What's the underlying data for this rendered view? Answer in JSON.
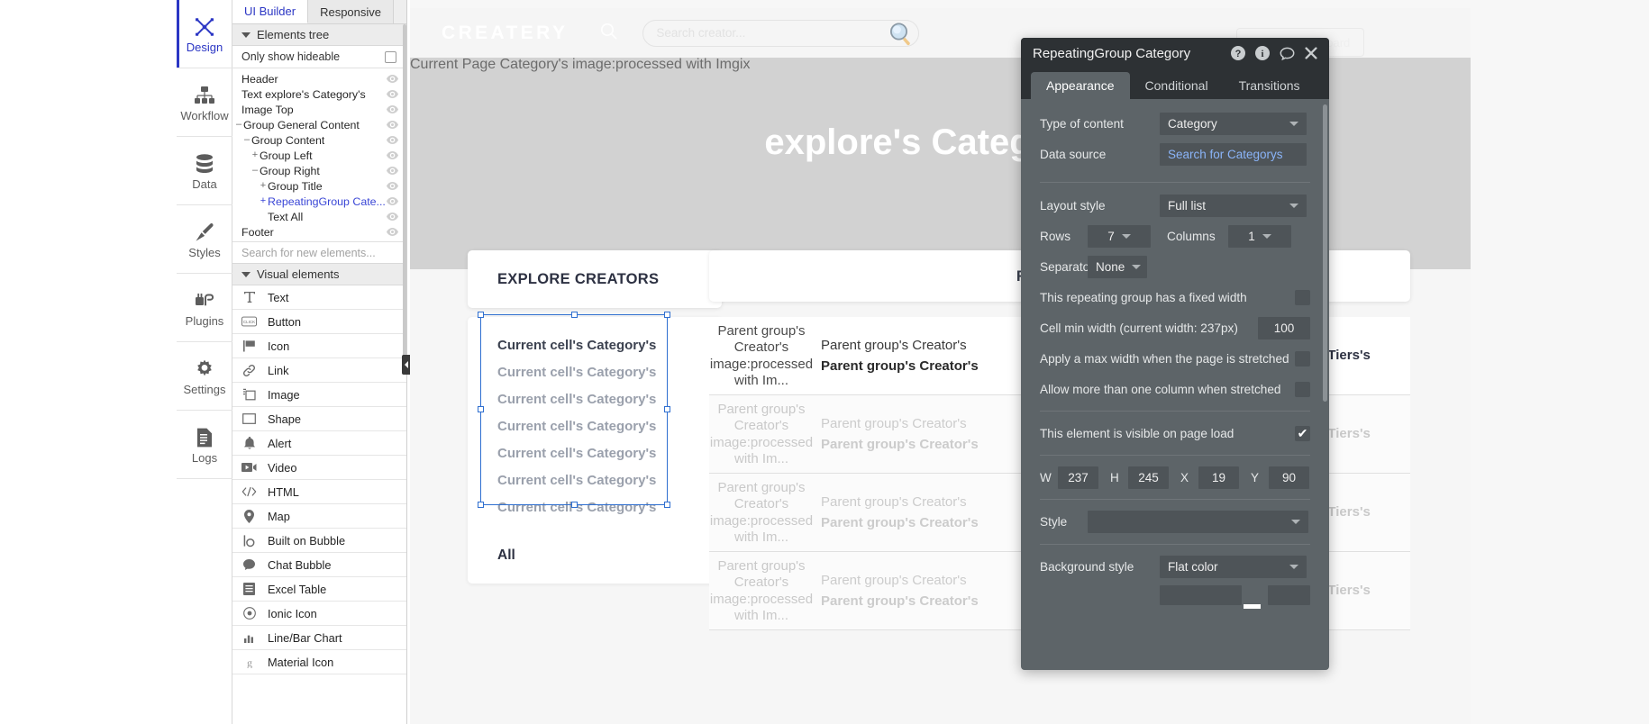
{
  "builder": {
    "tabs": [
      {
        "label": "UI Builder",
        "active": true
      },
      {
        "label": "Responsive",
        "active": false
      }
    ]
  },
  "nav_rail": {
    "items": [
      {
        "label": "Design",
        "icon": "design-icon",
        "active": true
      },
      {
        "label": "Workflow",
        "icon": "workflow-icon",
        "active": false
      },
      {
        "label": "Data",
        "icon": "database-icon",
        "active": false
      },
      {
        "label": "Styles",
        "icon": "brush-icon",
        "active": false
      },
      {
        "label": "Plugins",
        "icon": "plug-icon",
        "active": false
      },
      {
        "label": "Settings",
        "icon": "gear-icon",
        "active": false
      },
      {
        "label": "Logs",
        "icon": "document-icon",
        "active": false
      }
    ]
  },
  "elements_tree": {
    "section_label": "Elements tree",
    "hideable_label": "Only show hideable",
    "hideable_checked": false,
    "search_placeholder": "Search for new elements...",
    "nodes": [
      {
        "label": "Header",
        "indent": 0,
        "twist": "",
        "selected": false
      },
      {
        "label": "Text explore's Category's",
        "indent": 0,
        "twist": "",
        "selected": false
      },
      {
        "label": "Image Top",
        "indent": 0,
        "twist": "",
        "selected": false
      },
      {
        "label": "Group General Content",
        "indent": 0,
        "twist": "–",
        "selected": false
      },
      {
        "label": "Group Content",
        "indent": 1,
        "twist": "–",
        "selected": false
      },
      {
        "label": "Group Left",
        "indent": 2,
        "twist": "+",
        "selected": false
      },
      {
        "label": "Group Right",
        "indent": 2,
        "twist": "–",
        "selected": false
      },
      {
        "label": "Group Title",
        "indent": 3,
        "twist": "+",
        "selected": false
      },
      {
        "label": "RepeatingGroup Cate...",
        "indent": 3,
        "twist": "+",
        "selected": true
      },
      {
        "label": "Text All",
        "indent": 3,
        "twist": "",
        "selected": false
      },
      {
        "label": "Footer",
        "indent": 0,
        "twist": "",
        "selected": false
      }
    ]
  },
  "visual_elements": {
    "section_label": "Visual elements",
    "items": [
      {
        "label": "Text",
        "icon": "text-icon"
      },
      {
        "label": "Button",
        "icon": "button-icon"
      },
      {
        "label": "Icon",
        "icon": "flag-icon"
      },
      {
        "label": "Link",
        "icon": "link-icon"
      },
      {
        "label": "Image",
        "icon": "image-icon"
      },
      {
        "label": "Shape",
        "icon": "shape-icon"
      },
      {
        "label": "Alert",
        "icon": "bell-icon"
      },
      {
        "label": "Video",
        "icon": "video-icon"
      },
      {
        "label": "HTML",
        "icon": "code-icon"
      },
      {
        "label": "Map",
        "icon": "map-pin-icon"
      },
      {
        "label": "Built on Bubble",
        "icon": "bubble-logo-icon"
      },
      {
        "label": "Chat Bubble",
        "icon": "chat-bubble-icon"
      },
      {
        "label": "Excel Table",
        "icon": "table-icon"
      },
      {
        "label": "Ionic Icon",
        "icon": "ionic-icon"
      },
      {
        "label": "Line/Bar Chart",
        "icon": "bar-chart-icon"
      },
      {
        "label": "Material Icon",
        "icon": "material-icon"
      }
    ]
  },
  "canvas": {
    "header": {
      "brand": "CREATERY",
      "search_placeholder": "Search creator...",
      "dashboard_button": "Creator Dashboard"
    },
    "hero": {
      "image_text": "Current Page Category's image:processed with Imgix",
      "title": "explore's Category's"
    },
    "left_card": {
      "title": "EXPLORE CREATORS",
      "cells": [
        "Current cell's Category's",
        "Current cell's Category's",
        "Current cell's Category's",
        "Current cell's Category's",
        "Current cell's Category's",
        "Current cell's Category's",
        "Current cell's Category's"
      ],
      "all_label": "All"
    },
    "right_card": {
      "title": "Repeating...",
      "rows": [
        {
          "thumb": "Parent group's Creator's image:processed with Im...",
          "line1": "Parent group's Creator's",
          "line2": "Parent group's Creator's",
          "right": "Search for Tiers's",
          "dim": false
        },
        {
          "thumb": "Parent group's Creator's image:processed with Im...",
          "line1": "Parent group's Creator's",
          "line2": "Parent group's Creator's",
          "right": "Search for Tiers's",
          "dim": true
        },
        {
          "thumb": "Parent group's Creator's image:processed with Im...",
          "line1": "Parent group's Creator's",
          "line2": "Parent group's Creator's",
          "right": "Search for Tiers's",
          "dim": true
        },
        {
          "thumb": "Parent group's Creator's image:processed with Im...",
          "line1": "Parent group's Creator's",
          "line2": "Parent group's Creator's",
          "right": "Search for Tiers's",
          "dim": true
        }
      ]
    }
  },
  "property_editor": {
    "title": "RepeatingGroup Category",
    "title_icons": [
      "help-icon",
      "info-icon",
      "comment-icon",
      "close-icon"
    ],
    "tabs": [
      {
        "label": "Appearance",
        "active": true
      },
      {
        "label": "Conditional",
        "active": false
      },
      {
        "label": "Transitions",
        "active": false
      }
    ],
    "type_of_content": {
      "label": "Type of content",
      "value": "Category"
    },
    "data_source": {
      "label": "Data source",
      "value": "Search for Categorys"
    },
    "layout_style": {
      "label": "Layout style",
      "value": "Full list"
    },
    "rows": {
      "label": "Rows",
      "value": "7"
    },
    "columns": {
      "label": "Columns",
      "value": "1"
    },
    "separator": {
      "label": "Separato",
      "value": "None"
    },
    "checkboxes": [
      {
        "label": "This repeating group has a fixed width",
        "checked": false
      },
      {
        "label": "Apply a max width when the page is stretched",
        "checked": false
      },
      {
        "label": "Allow more than one column when stretched",
        "checked": false
      }
    ],
    "cell_min_width": {
      "label": "Cell min width (current width: 237px)",
      "value": "100"
    },
    "visible_on_load": {
      "label": "This element is visible on page load",
      "checked": true
    },
    "geometry": {
      "w_label": "W",
      "w": "237",
      "h_label": "H",
      "h": "245",
      "x_label": "X",
      "x": "19",
      "y_label": "Y",
      "y": "90"
    },
    "style": {
      "label": "Style",
      "value": ""
    },
    "background": {
      "label": "Background style",
      "value": "Flat color"
    }
  },
  "colors": {
    "accent_blue": "#2b36c4",
    "selection_blue": "#2f6fd0",
    "panel_bg": "#5d6468",
    "panel_titlebar": "#2d3134",
    "hero_gray": "#d2d2d2",
    "link_blue": "#8ab4f8"
  }
}
